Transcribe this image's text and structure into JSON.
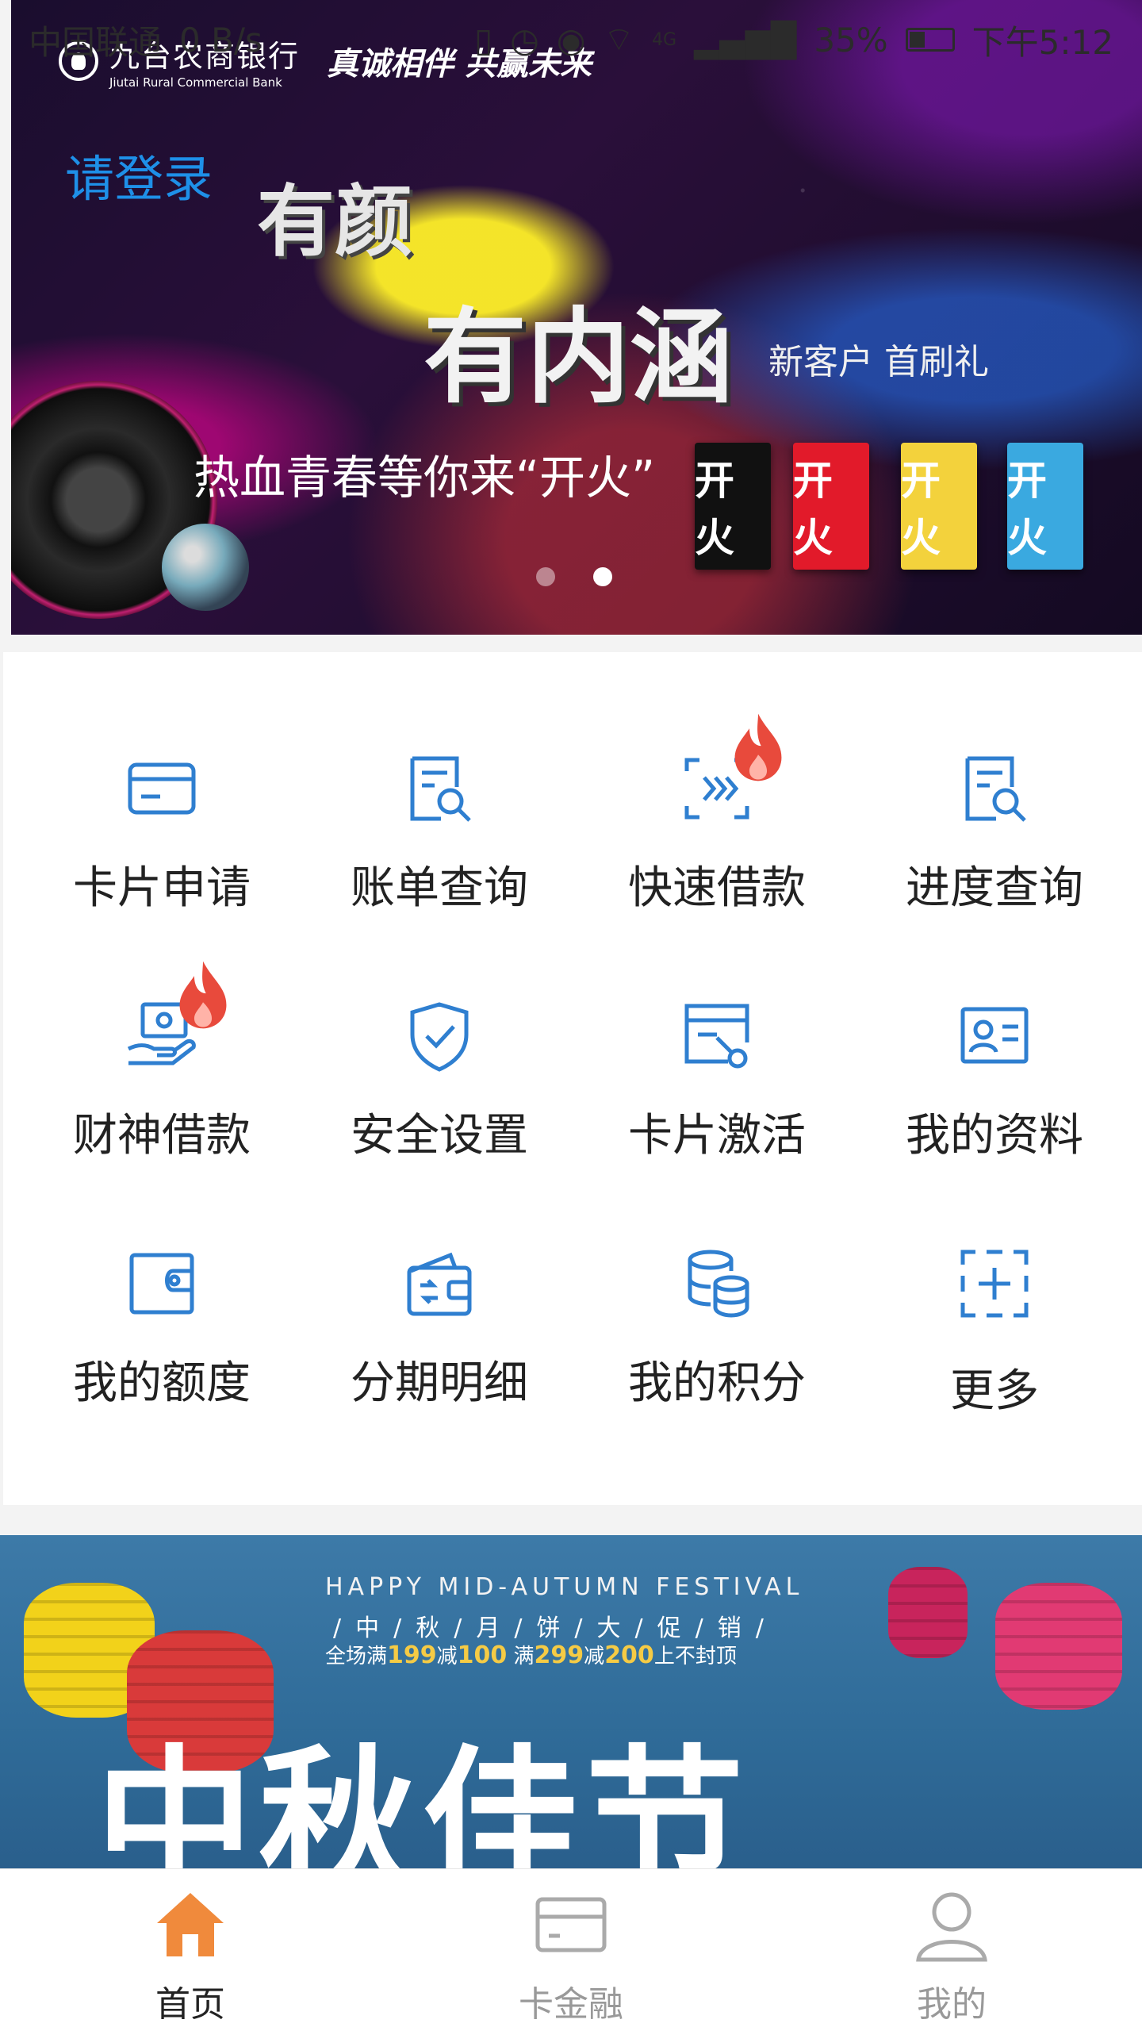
{
  "status_bar": {
    "carrier": "中国联通",
    "speed": "0 B/s",
    "network": "4G",
    "battery": "35%",
    "time": "下午5:12"
  },
  "hero": {
    "bank_name": "九台农商银行",
    "bank_name_en": "Jiutai Rural Commercial Bank",
    "slogan": "真诚相伴 共赢未来",
    "login_prompt": "请登录",
    "title_line1": "有颜",
    "title_line2": "有内涵",
    "sub_text": "新客户 首刷礼",
    "tagline": "热血青春等你来“开火”",
    "card_label": "开火",
    "slide_count": 2,
    "active_slide": 2
  },
  "menu": {
    "items": [
      {
        "label": "卡片申请",
        "icon": "card-icon",
        "hot": false
      },
      {
        "label": "账单查询",
        "icon": "bill-search-icon",
        "hot": false
      },
      {
        "label": "快速借款",
        "icon": "quick-loan-icon",
        "hot": true
      },
      {
        "label": "进度查询",
        "icon": "progress-search-icon",
        "hot": false
      },
      {
        "label": "财神借款",
        "icon": "hand-money-icon",
        "hot": true
      },
      {
        "label": "安全设置",
        "icon": "shield-check-icon",
        "hot": false
      },
      {
        "label": "卡片激活",
        "icon": "card-activate-icon",
        "hot": false
      },
      {
        "label": "我的资料",
        "icon": "profile-card-icon",
        "hot": false
      },
      {
        "label": "我的额度",
        "icon": "wallet-icon",
        "hot": false
      },
      {
        "label": "分期明细",
        "icon": "installment-wallet-icon",
        "hot": false
      },
      {
        "label": "我的积分",
        "icon": "coins-icon",
        "hot": false
      },
      {
        "label": "更多",
        "icon": "more-plus-icon",
        "hot": false
      }
    ],
    "accent_color": "#2f7fd0",
    "hot_color": "#e84a3c"
  },
  "promo": {
    "headline_en": "HAPPY MID-AUTUMN FESTIVAL",
    "line2": "/中/秋/月/饼/大/促/销/",
    "line3_pre": "全场满",
    "v199": "199",
    "reduce1": "减",
    "v100": "100",
    "line3_mid": " 满",
    "v299": "299",
    "reduce2": "减",
    "v200": "200",
    "line3_post": "上不封顶",
    "title": "中秋佳节"
  },
  "bottom_nav": {
    "items": [
      {
        "label": "首页",
        "icon": "home-icon",
        "active": true
      },
      {
        "label": "卡金融",
        "icon": "card-icon",
        "active": false
      },
      {
        "label": "我的",
        "icon": "user-icon",
        "active": false
      }
    ],
    "active_color": "#f08a3c"
  }
}
